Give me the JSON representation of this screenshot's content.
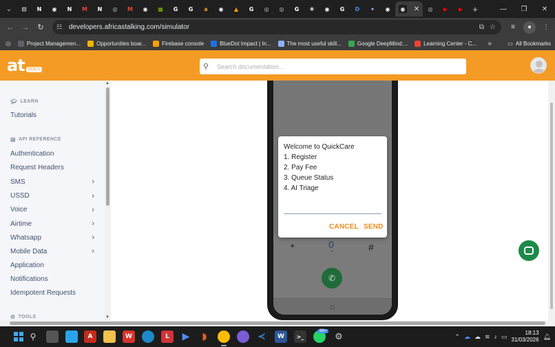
{
  "tabs": [
    {
      "icon": "chatgpt-icon",
      "color": "#ffffff",
      "glyph": "⊡"
    },
    {
      "icon": "notion-icon",
      "color": "#ffffff",
      "glyph": "N"
    },
    {
      "icon": "github-icon",
      "color": "#ffffff",
      "glyph": "◉"
    },
    {
      "icon": "notion-icon",
      "color": "#ffffff",
      "glyph": "N"
    },
    {
      "icon": "gmail-icon",
      "color": "#ea4335",
      "glyph": "M"
    },
    {
      "icon": "notion-icon",
      "color": "#ffffff",
      "glyph": "N"
    },
    {
      "icon": "web-icon",
      "color": "#c8c8c8",
      "glyph": "◎"
    },
    {
      "icon": "gmail-icon",
      "color": "#ea4335",
      "glyph": "M"
    },
    {
      "icon": "github-icon",
      "color": "#ffffff",
      "glyph": "◉"
    },
    {
      "icon": "microsoft-icon",
      "color": "#7fba00",
      "glyph": "▦"
    },
    {
      "icon": "google-icon",
      "color": "#ffffff",
      "glyph": "G"
    },
    {
      "icon": "google-icon",
      "color": "#ffffff",
      "glyph": "G"
    },
    {
      "icon": "at-icon",
      "color": "#f49b25",
      "glyph": "a"
    },
    {
      "icon": "github-icon",
      "color": "#ffffff",
      "glyph": "◉"
    },
    {
      "icon": "firebase-icon",
      "color": "#ffa000",
      "glyph": "▲"
    },
    {
      "icon": "google-icon",
      "color": "#ffffff",
      "glyph": "G"
    },
    {
      "icon": "web-icon",
      "color": "#c8c8c8",
      "glyph": "◎"
    },
    {
      "icon": "web-icon",
      "color": "#c8c8c8",
      "glyph": "◎"
    },
    {
      "icon": "google-icon",
      "color": "#ffffff",
      "glyph": "G"
    },
    {
      "icon": "chatgpt-icon",
      "color": "#c8c8c8",
      "glyph": "✺"
    },
    {
      "icon": "github-icon",
      "color": "#ffffff",
      "glyph": "◉"
    },
    {
      "icon": "google-icon",
      "color": "#ffffff",
      "glyph": "G"
    },
    {
      "icon": "docs-icon",
      "color": "#4c8df6",
      "glyph": "D"
    },
    {
      "icon": "gemini-icon",
      "color": "#8ab4f8",
      "glyph": "✦"
    },
    {
      "icon": "github-icon",
      "color": "#ffffff",
      "glyph": "◉"
    }
  ],
  "tabs_after": [
    {
      "icon": "web-icon",
      "color": "#c8c8c8",
      "glyph": "◎"
    },
    {
      "icon": "youtube-icon",
      "color": "#ff0000",
      "glyph": "▶"
    },
    {
      "icon": "youtube-icon",
      "color": "#ff0000",
      "glyph": "▶"
    }
  ],
  "browser": {
    "url": "developers.africastalking.com/simulator"
  },
  "bookmarks": [
    {
      "label": "Project Managemen...",
      "color": "#5f6368"
    },
    {
      "label": "Opportunities boar...",
      "color": "#f4b400"
    },
    {
      "label": "Firebase console",
      "color": "#ffa000"
    },
    {
      "label": "BluеDot Impact | In...",
      "color": "#1a73e8"
    },
    {
      "label": "The most useful skill...",
      "color": "#8ab4f8"
    },
    {
      "label": "Google DeepMind:...",
      "color": "#34a853"
    },
    {
      "label": "Learning Center - C...",
      "color": "#ea4335"
    }
  ],
  "bookmarks_all": "All Bookmarks",
  "header": {
    "logo_text": "at",
    "logo_badge": "DOCS",
    "search_placeholder": "Search documentation..."
  },
  "sidebar": {
    "learn_title": "LEARN",
    "learn_items": [
      "Tutorials"
    ],
    "api_title": "API REFERENCE",
    "api_items": [
      {
        "label": "Authentication",
        "chevron": false
      },
      {
        "label": "Request Headers",
        "chevron": false
      },
      {
        "label": "SMS",
        "chevron": true
      },
      {
        "label": "USSD",
        "chevron": true
      },
      {
        "label": "Voice",
        "chevron": true
      },
      {
        "label": "Airtime",
        "chevron": true
      },
      {
        "label": "Whatsapp",
        "chevron": true
      },
      {
        "label": "Mobile Data",
        "chevron": true
      },
      {
        "label": "Application",
        "chevron": false
      },
      {
        "label": "Notifications",
        "chevron": false
      },
      {
        "label": "Idempotent Requests",
        "chevron": false
      }
    ],
    "tools_title": "TOOLS"
  },
  "phone": {
    "keys": {
      "star": "*",
      "zero": "0",
      "plus": "+",
      "hash": "#"
    }
  },
  "dialog": {
    "lines": [
      "Welcome to QuickCare",
      "1. Register",
      "2. Pay Fee",
      "3. Queue Status",
      "4. AI Triage"
    ],
    "input_value": "",
    "cancel_label": "CANCEL",
    "send_label": "SEND"
  },
  "taskbar": {
    "badge": "99+",
    "time": "18:13",
    "date": "31/03/2026"
  }
}
